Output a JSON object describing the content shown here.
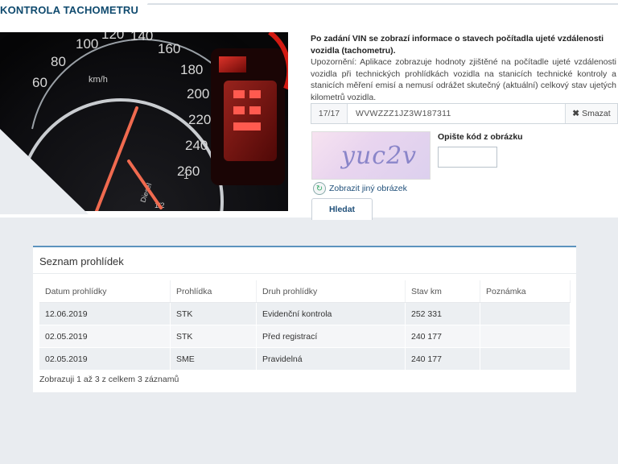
{
  "header": {
    "title": "KONTROLA TACHOMETRU"
  },
  "gauge": {
    "ticks": [
      "60",
      "80",
      "100",
      "120",
      "140",
      "160",
      "180",
      "200",
      "220",
      "240",
      "260"
    ],
    "unit": "km/h",
    "fuel_label": "Diesel",
    "fuel_full": "1",
    "fuel_half": "1/2"
  },
  "info": {
    "heading": "Po zadání VIN se zobrazí informace o stavech počítadla ujeté vzdálenosti vozidla (tachometru).",
    "notice": "Upozornění: Aplikace zobrazuje hodnoty zjištěné na počítadle ujeté vzdálenosti vozidla při technických prohlídkách vozidla na stanicích technické kontroly a stanicích měření emisí a nemusí odrážet skutečný (aktuální) celkový stav ujetých kilometrů vozidla."
  },
  "vin": {
    "count": "17/17",
    "value": "WVWZZZ1JZ3W187311",
    "clear_label": "Smazat",
    "clear_icon": "times-icon"
  },
  "captcha": {
    "text": "yuc2v",
    "code_label": "Opište kód z obrázku",
    "code_value": "",
    "refresh_label": "Zobrazit jiný obrázek",
    "refresh_icon": "refresh-icon"
  },
  "search": {
    "label": "Hledat"
  },
  "panel": {
    "title": "Seznam prohlídek",
    "columns": [
      "Datum prohlídky",
      "Prohlídka",
      "Druh prohlídky",
      "Stav km",
      "Poznámka"
    ],
    "rows": [
      [
        "12.06.2019",
        "STK",
        "Evidenční kontrola",
        "252 331",
        ""
      ],
      [
        "02.05.2019",
        "STK",
        "Před registrací",
        "240 177",
        ""
      ],
      [
        "02.05.2019",
        "SME",
        "Pravidelná",
        "240 177",
        ""
      ]
    ],
    "footer": "Zobrazuji 1 až 3 z celkem 3 záznamů"
  }
}
